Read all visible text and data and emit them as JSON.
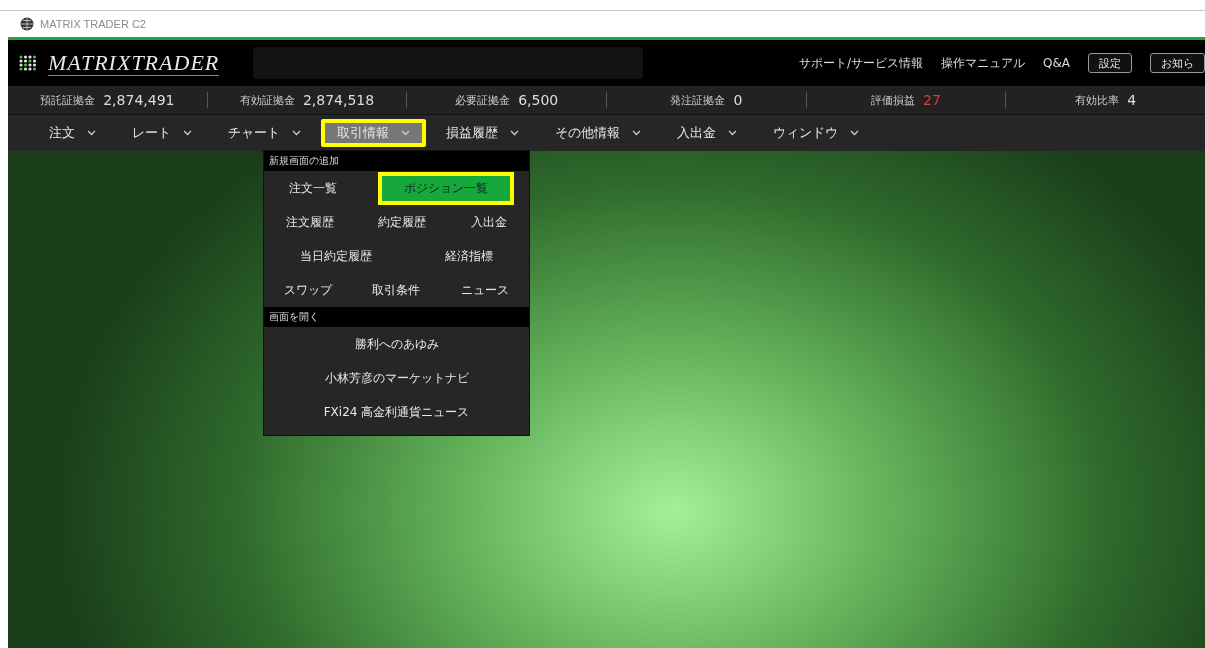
{
  "window": {
    "title": "MATRIX TRADER C2"
  },
  "header": {
    "logo": "MATRIXTRADER",
    "links": [
      "サポート/サービス情報",
      "操作マニュアル",
      "Q&A"
    ],
    "buttons": [
      "設定",
      "お知ら"
    ]
  },
  "stats": [
    {
      "label": "預託証拠金",
      "value": "2,874,491"
    },
    {
      "label": "有効証拠金",
      "value": "2,874,518"
    },
    {
      "label": "必要証拠金",
      "value": "6,500"
    },
    {
      "label": "発注証拠金",
      "value": "0"
    },
    {
      "label": "評価損益",
      "value": "27",
      "color": "#d83c3c"
    },
    {
      "label": "有効比率",
      "value": "4"
    }
  ],
  "menu": [
    {
      "label": "注文",
      "selected": false,
      "highlighted": false
    },
    {
      "label": "レート",
      "selected": false,
      "highlighted": false
    },
    {
      "label": "チャート",
      "selected": false,
      "highlighted": false
    },
    {
      "label": "取引情報",
      "selected": true,
      "highlighted": true
    },
    {
      "label": "損益履歴",
      "selected": false,
      "highlighted": false
    },
    {
      "label": "その他情報",
      "selected": false,
      "highlighted": false
    },
    {
      "label": "入出金",
      "selected": false,
      "highlighted": false
    },
    {
      "label": "ウィンドウ",
      "selected": false,
      "highlighted": false
    }
  ],
  "dropdown": [
    {
      "kind": "section",
      "label": "新規画面の追加"
    },
    {
      "kind": "row",
      "items": [
        {
          "label": "注文一覧",
          "selected": false,
          "highlighted": false
        },
        {
          "label": "ポジション一覧",
          "selected": true,
          "highlighted": true
        }
      ]
    },
    {
      "kind": "row",
      "items": [
        {
          "label": "注文履歴",
          "selected": false,
          "highlighted": false
        },
        {
          "label": "約定履歴",
          "selected": false,
          "highlighted": false
        },
        {
          "label": "入出金",
          "selected": false,
          "highlighted": false
        }
      ]
    },
    {
      "kind": "row",
      "items": [
        {
          "label": "当日約定履歴",
          "selected": false,
          "highlighted": false
        },
        {
          "label": "経済指標",
          "selected": false,
          "highlighted": false
        }
      ]
    },
    {
      "kind": "row",
      "items": [
        {
          "label": "スワップ",
          "selected": false,
          "highlighted": false
        },
        {
          "label": "取引条件",
          "selected": false,
          "highlighted": false
        },
        {
          "label": "ニュース",
          "selected": false,
          "highlighted": false
        }
      ]
    },
    {
      "kind": "section",
      "label": "画面を開く"
    },
    {
      "kind": "row",
      "items": [
        {
          "label": "勝利へのあゆみ",
          "selected": false,
          "highlighted": false
        }
      ]
    },
    {
      "kind": "row",
      "items": [
        {
          "label": "小林芳彦のマーケットナビ",
          "selected": false,
          "highlighted": false
        }
      ]
    },
    {
      "kind": "row",
      "items": [
        {
          "label": "FXi24 高金利通貨ニュース",
          "selected": false,
          "highlighted": false
        }
      ]
    }
  ]
}
